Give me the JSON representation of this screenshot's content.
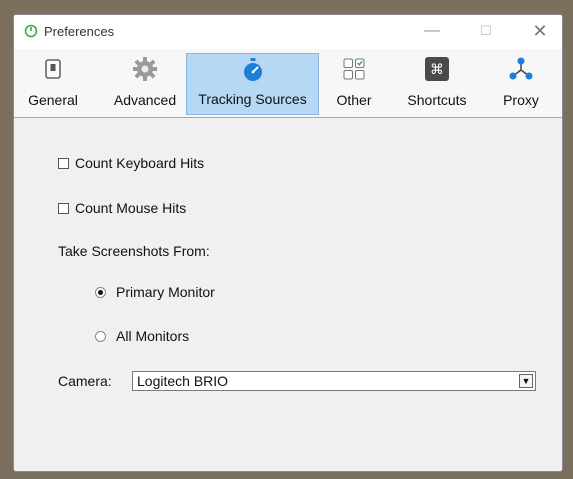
{
  "window": {
    "title": "Preferences",
    "controls": {
      "minimize": "—",
      "maximize": "☐",
      "close": "✕"
    }
  },
  "toolbar": {
    "tabs": [
      {
        "label": "General",
        "icon": "switch-icon"
      },
      {
        "label": "Advanced",
        "icon": "gear-icon"
      },
      {
        "label": "Tracking Sources",
        "icon": "stopwatch-icon",
        "active": true
      },
      {
        "label": "Other",
        "icon": "checkbox-grid-icon"
      },
      {
        "label": "Shortcuts",
        "icon": "command-key-icon"
      },
      {
        "label": "Proxy",
        "icon": "network-icon"
      }
    ]
  },
  "content": {
    "count_keyboard_hits": {
      "label": "Count Keyboard Hits",
      "checked": false
    },
    "count_mouse_hits": {
      "label": "Count Mouse Hits",
      "checked": false
    },
    "screenshots_label": "Take Screenshots From:",
    "screenshot_options": [
      {
        "label": "Primary Monitor",
        "selected": true
      },
      {
        "label": "All Monitors",
        "selected": false
      }
    ],
    "camera": {
      "label": "Camera:",
      "value": "Logitech BRIO"
    }
  },
  "colors": {
    "active_tab_bg": "#b5d8f5",
    "accent_blue": "#1f7fd6",
    "app_icon_green": "#35a853"
  }
}
